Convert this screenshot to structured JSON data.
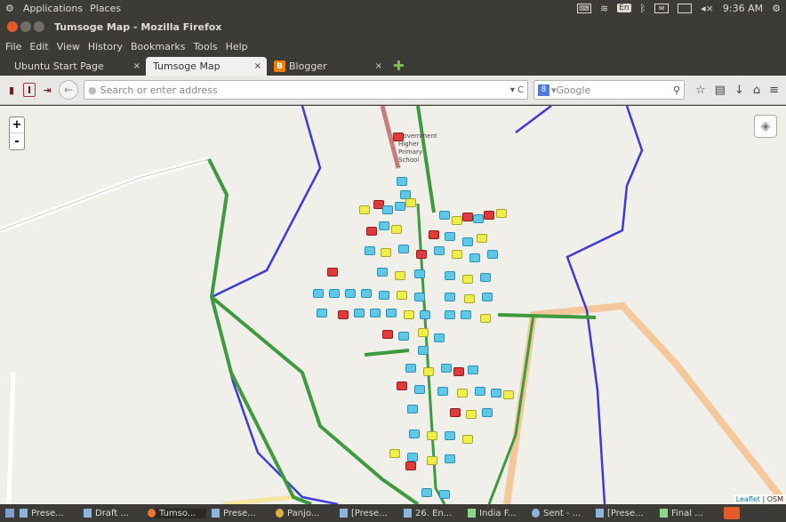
{
  "top_panel": {
    "menus": [
      "Applications",
      "Places"
    ],
    "ime": "En",
    "time": "9:36 AM"
  },
  "window": {
    "title": "Tumsoge Map - Mozilla Firefox"
  },
  "menubar": [
    "File",
    "Edit",
    "View",
    "History",
    "Bookmarks",
    "Tools",
    "Help"
  ],
  "tabs": [
    {
      "label": "Ubuntu Start Page",
      "active": false
    },
    {
      "label": "Tumsoge Map",
      "active": true
    },
    {
      "label": "Blogger",
      "active": false
    }
  ],
  "navbar": {
    "url_placeholder": "Search or enter address",
    "search_placeholder": "Google"
  },
  "map": {
    "zoom_in": "+",
    "zoom_out": "-",
    "school_label": [
      "Government",
      "Higher",
      "Primary",
      "School"
    ],
    "attribution_link": "Leaflet",
    "attribution_text": " | OSM"
  },
  "taskbar": [
    "Prese...",
    "Draft ...",
    "Tumso...",
    "Prese...",
    "Panjo...",
    "[Prese...",
    "26. En...",
    "India F...",
    "Sent - ...",
    "[Prese...",
    "Final ..."
  ],
  "colors": {
    "panel": "#3c3b37",
    "map_bg": "#f1efe9",
    "road_green": "#3d9a3d",
    "boundary_blue": "#3b3bd8",
    "road_orange": "#f4c89a"
  }
}
